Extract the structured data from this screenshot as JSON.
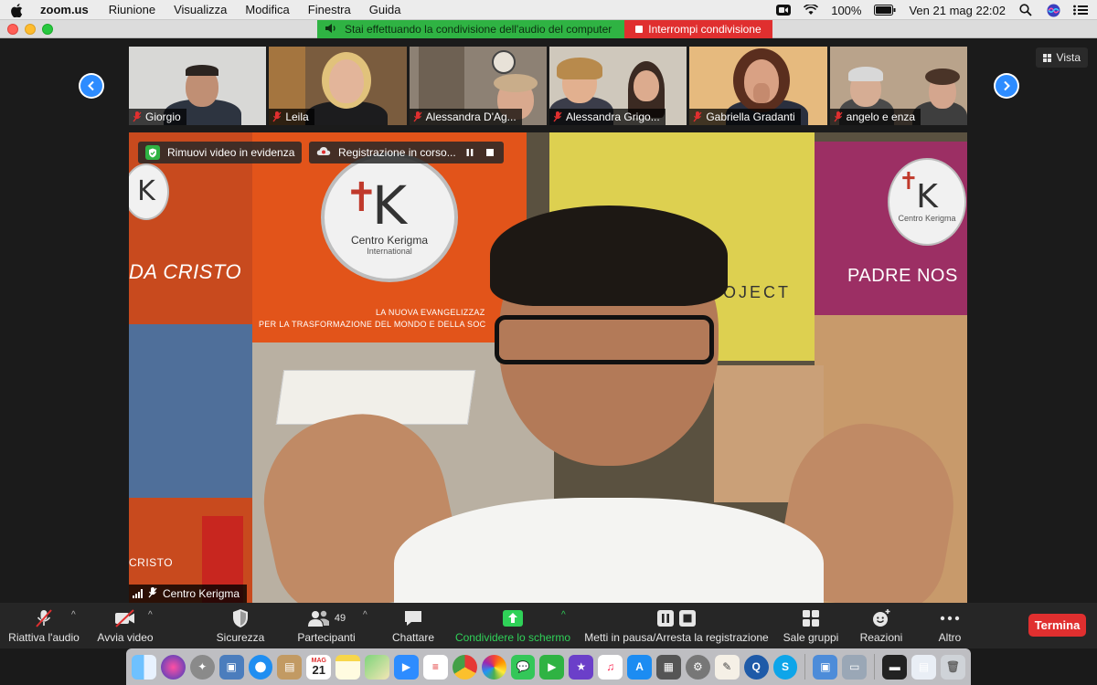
{
  "menubar": {
    "app_name": "zoom.us",
    "menus": [
      "Riunione",
      "Visualizza",
      "Modifica",
      "Finestra",
      "Guida"
    ],
    "battery": "100%",
    "datetime": "Ven 21 mag  22:02"
  },
  "share_banner": {
    "status": "Stai effettuando la condivisione dell'audio del computer",
    "stop_label": "Interrompi condivisione"
  },
  "view_button": {
    "label": "Vista"
  },
  "thumbnails": [
    {
      "name": "Giorgio"
    },
    {
      "name": "Leila"
    },
    {
      "name": "Alessandra D'Ag..."
    },
    {
      "name": "Alessandra Grigo..."
    },
    {
      "name": "Gabriella Gradanti"
    },
    {
      "name": "angelo e enza"
    }
  ],
  "main_video": {
    "spotlight_label": "Rimuovi video in evidenza",
    "recording_label": "Registrazione in corso...",
    "speaker_name": "Centro Kerigma",
    "background": {
      "logo_name": "Centro Kerigma",
      "logo_sub": "International",
      "wall_text_left": "DA CRISTO",
      "wall_text_right": "PADRE NOS",
      "wall_small_1": "LA NUOVA EVANGELIZZAZ",
      "wall_small_2": "PER LA TRASFORMAZIONE DEL MONDO E DELLA SOC",
      "project_text": "OJECT",
      "cristo_text": "CRISTO"
    }
  },
  "toolbar": {
    "audio_label": "Riattiva l'audio",
    "video_label": "Avvia video",
    "security_label": "Sicurezza",
    "participants_label": "Partecipanti",
    "participants_count": "49",
    "chat_label": "Chattare",
    "share_label": "Condividere lo schermo",
    "record_label": "Metti in pausa/Arresta la registrazione",
    "breakout_label": "Sale gruppi",
    "reactions_label": "Reazioni",
    "more_label": "Altro",
    "end_label": "Termina"
  },
  "dock": {
    "calendar_month": "MAG",
    "calendar_day": "21"
  },
  "colors": {
    "share_green": "#2fb343",
    "stop_red": "#e02f2f",
    "accent_blue": "#2d8cff",
    "toolbar_bg": "#262626"
  }
}
